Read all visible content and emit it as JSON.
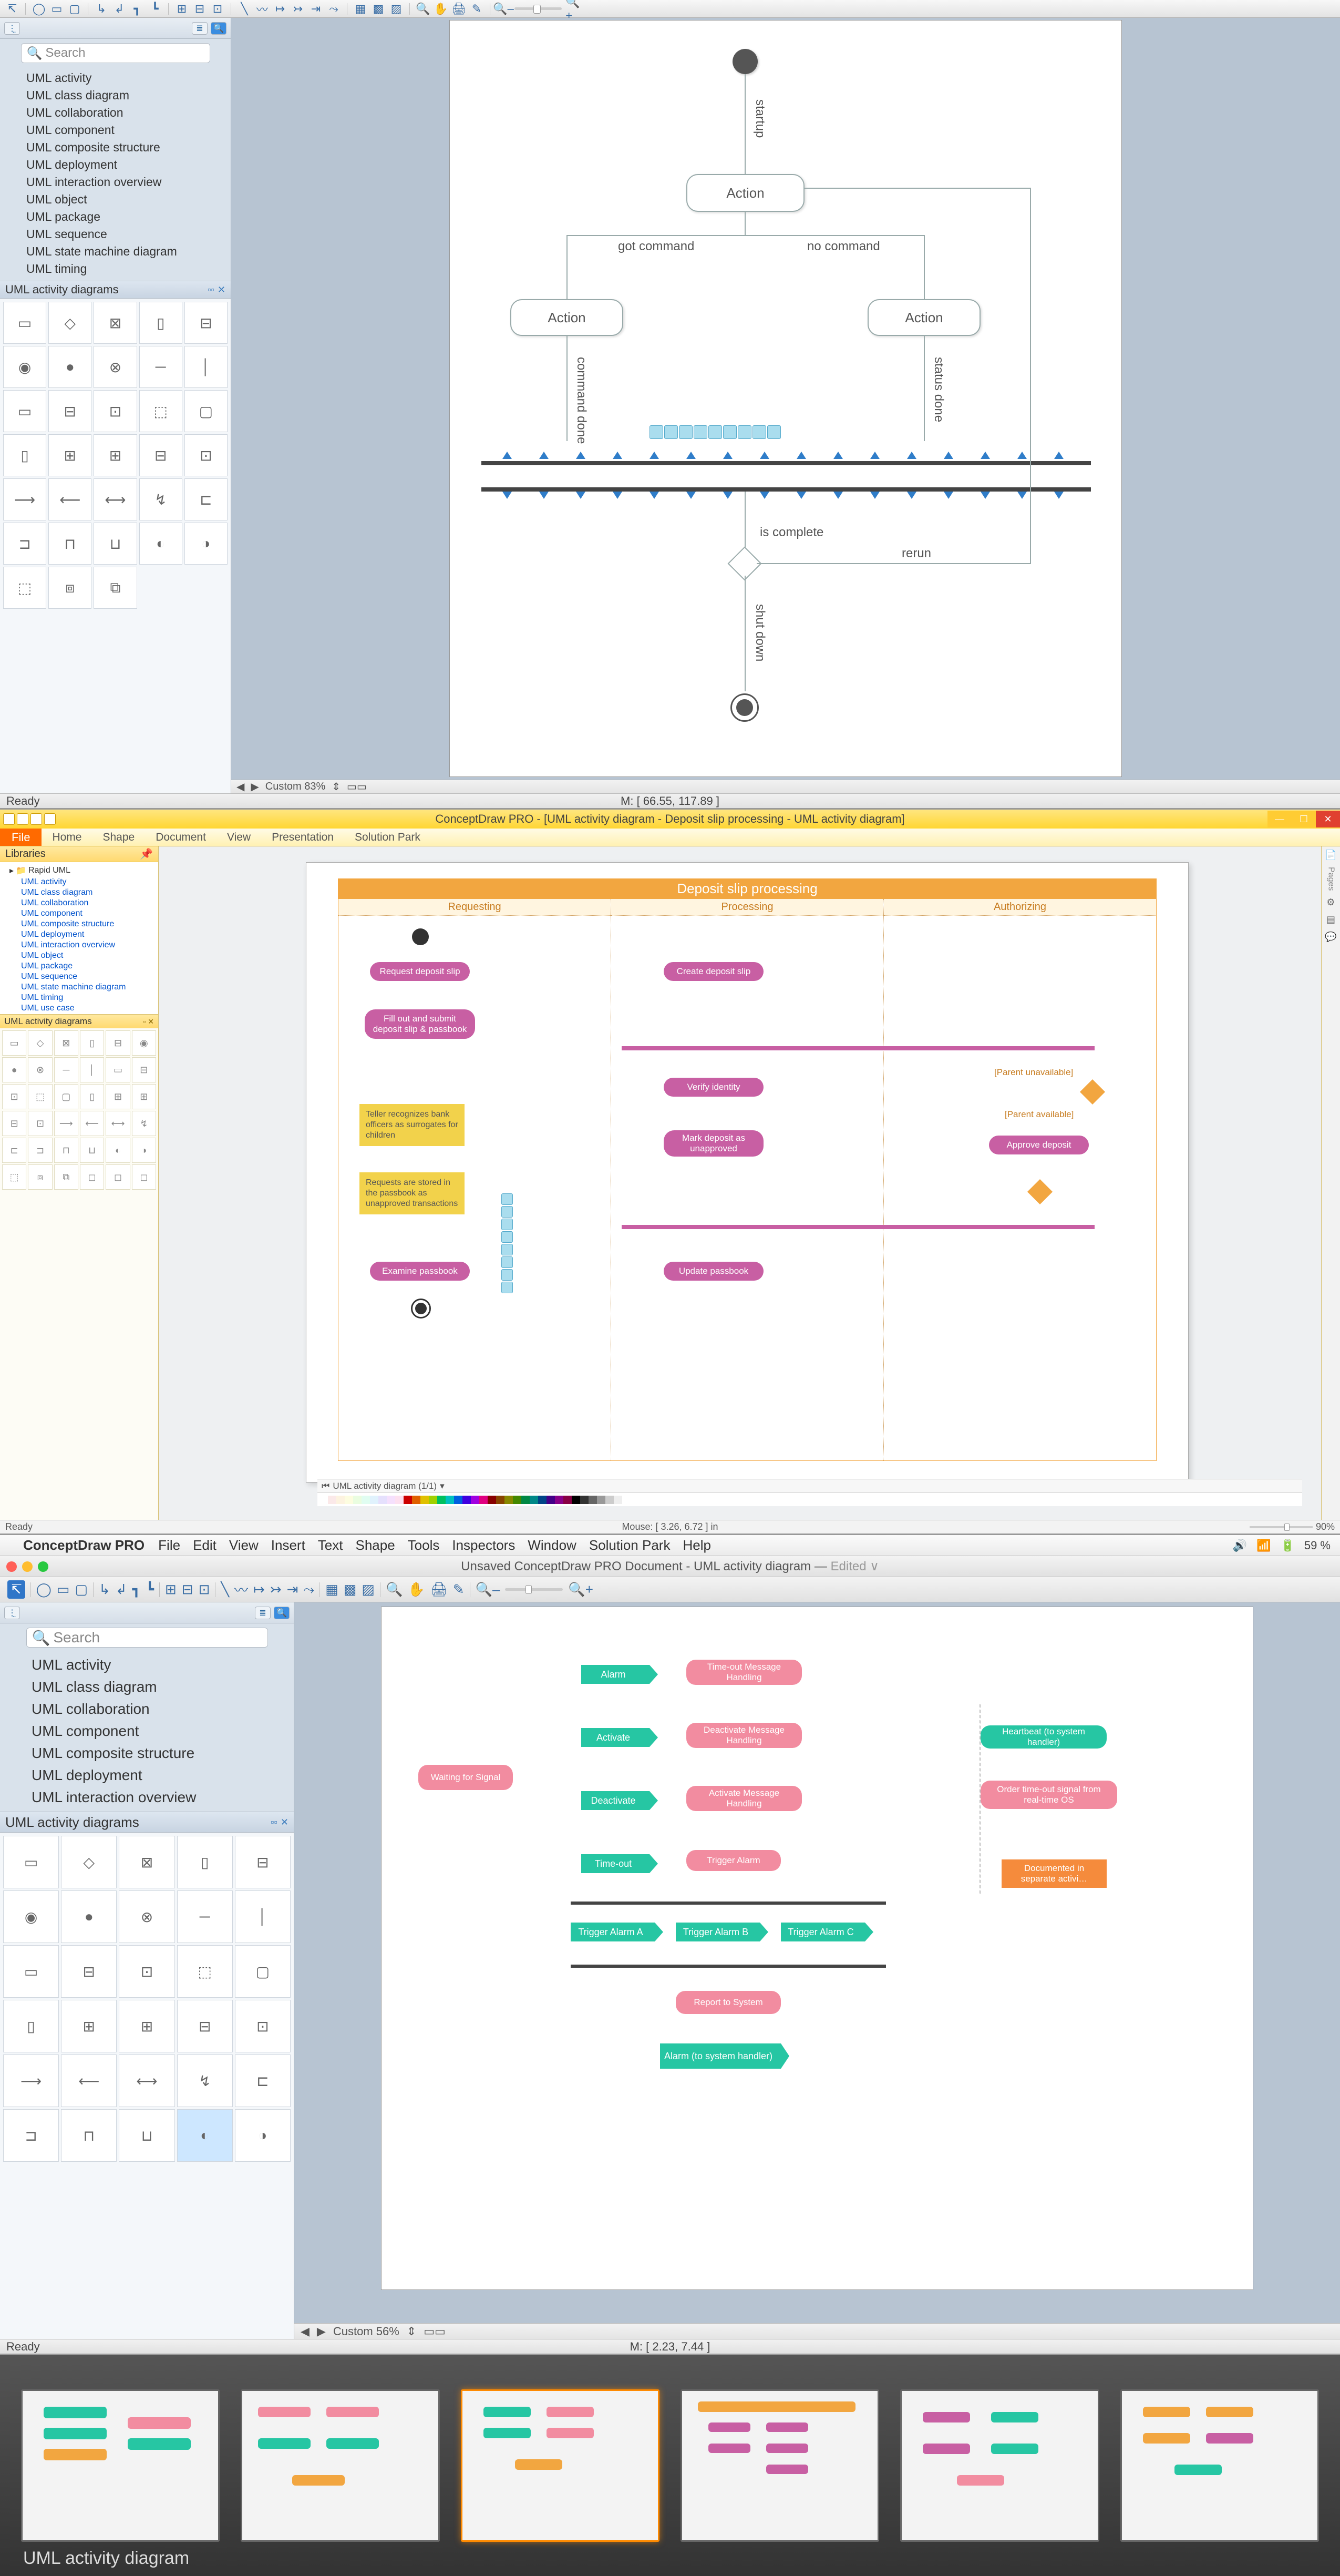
{
  "panel1": {
    "search_placeholder": "Search",
    "library_items": [
      "UML activity",
      "UML class diagram",
      "UML collaboration",
      "UML component",
      "UML composite structure",
      "UML deployment",
      "UML interaction overview",
      "UML object",
      "UML package",
      "UML sequence",
      "UML state machine diagram",
      "UML timing"
    ],
    "shapes_header": "UML activity diagrams",
    "status_left": "Ready",
    "zoom_label": "Custom 83%",
    "status_center": "M: [ 66.55, 117.89 ]",
    "diagram": {
      "action1": "Action",
      "action2": "Action",
      "action3": "Action",
      "startup": "startup",
      "got_command": "got command",
      "no_command": "no command",
      "command_done": "command done",
      "status_done": "status done",
      "is_complete": "is complete",
      "rerun": "rerun",
      "shut_down": "shut down"
    }
  },
  "panel2": {
    "window_title": "ConceptDraw PRO - [UML activity diagram - Deposit slip processing - UML activity diagram]",
    "ribbon": {
      "file": "File",
      "tabs": [
        "Home",
        "Shape",
        "Document",
        "View",
        "Presentation",
        "Solution Park"
      ]
    },
    "libraries_header": "Libraries",
    "tree_root": "Rapid UML",
    "tree_items": [
      "UML activity",
      "UML class diagram",
      "UML collaboration",
      "UML component",
      "UML composite structure",
      "UML deployment",
      "UML interaction overview",
      "UML object",
      "UML package",
      "UML sequence",
      "UML state machine diagram",
      "UML timing",
      "UML use case"
    ],
    "shapes_header": "UML activity diagrams",
    "page_tab": "UML activity diagram (1/1)",
    "status_left": "Ready",
    "status_center": "Mouse: [ 3.26, 6.72 ] in",
    "status_zoom": "90%",
    "diagram": {
      "title": "Deposit slip processing",
      "col_headers": [
        "Requesting",
        "Processing",
        "Authorizing"
      ],
      "request_slip": "Request deposit slip",
      "create_slip": "Create deposit slip",
      "fill_out": "Fill out and submit deposit slip & passbook",
      "verify": "Verify identity",
      "mark_unapproved": "Mark deposit as unapproved",
      "approve": "Approve deposit",
      "examine": "Examine passbook",
      "update": "Update passbook",
      "note1": "Teller recognizes bank officers as surrogates for children",
      "note2": "Requests are stored in the passbook as unapproved transactions",
      "parent_unavail": "[Parent unavailable]",
      "parent_avail": "[Parent available]"
    },
    "right_strip": {
      "pages": "Pages"
    }
  },
  "panel3": {
    "app_name": "ConceptDraw PRO",
    "menus": [
      "File",
      "Edit",
      "View",
      "Insert",
      "Text",
      "Shape",
      "Tools",
      "Inspectors",
      "Window",
      "Solution Park",
      "Help"
    ],
    "battery_pct": "59 %",
    "window_title": "Unsaved ConceptDraw PRO Document - UML activity diagram —",
    "window_title_suffix": "Edited",
    "search_placeholder": "Search",
    "library_items": [
      "UML activity",
      "UML class diagram",
      "UML collaboration",
      "UML component",
      "UML composite structure",
      "UML deployment",
      "UML interaction overview"
    ],
    "shapes_header": "UML activity diagrams",
    "status_left": "Ready",
    "zoom_label": "Custom 56%",
    "status_center": "M: [ 2.23, 7.44 ]",
    "diagram": {
      "waiting": "Waiting for Signal",
      "alarm": "Alarm",
      "activate": "Activate",
      "deactivate": "Deactivate",
      "timeout": "Time-out",
      "timeout_msg": "Time-out Message Handling",
      "deact_msg": "Deactivate Message Handling",
      "act_msg": "Activate Message Handling",
      "trigger": "Trigger Alarm",
      "trig_a": "Trigger Alarm A",
      "trig_b": "Trigger Alarm B",
      "trig_c": "Trigger Alarm C",
      "report": "Report to System",
      "alarm2": "Alarm (to system handler)",
      "heartbeat": "Heartbeat (to system handler)",
      "order": "Order time-out signal from real-time OS",
      "doc_note": "Documented in separate activi…"
    }
  },
  "gallery": {
    "caption": "UML activity diagram"
  }
}
